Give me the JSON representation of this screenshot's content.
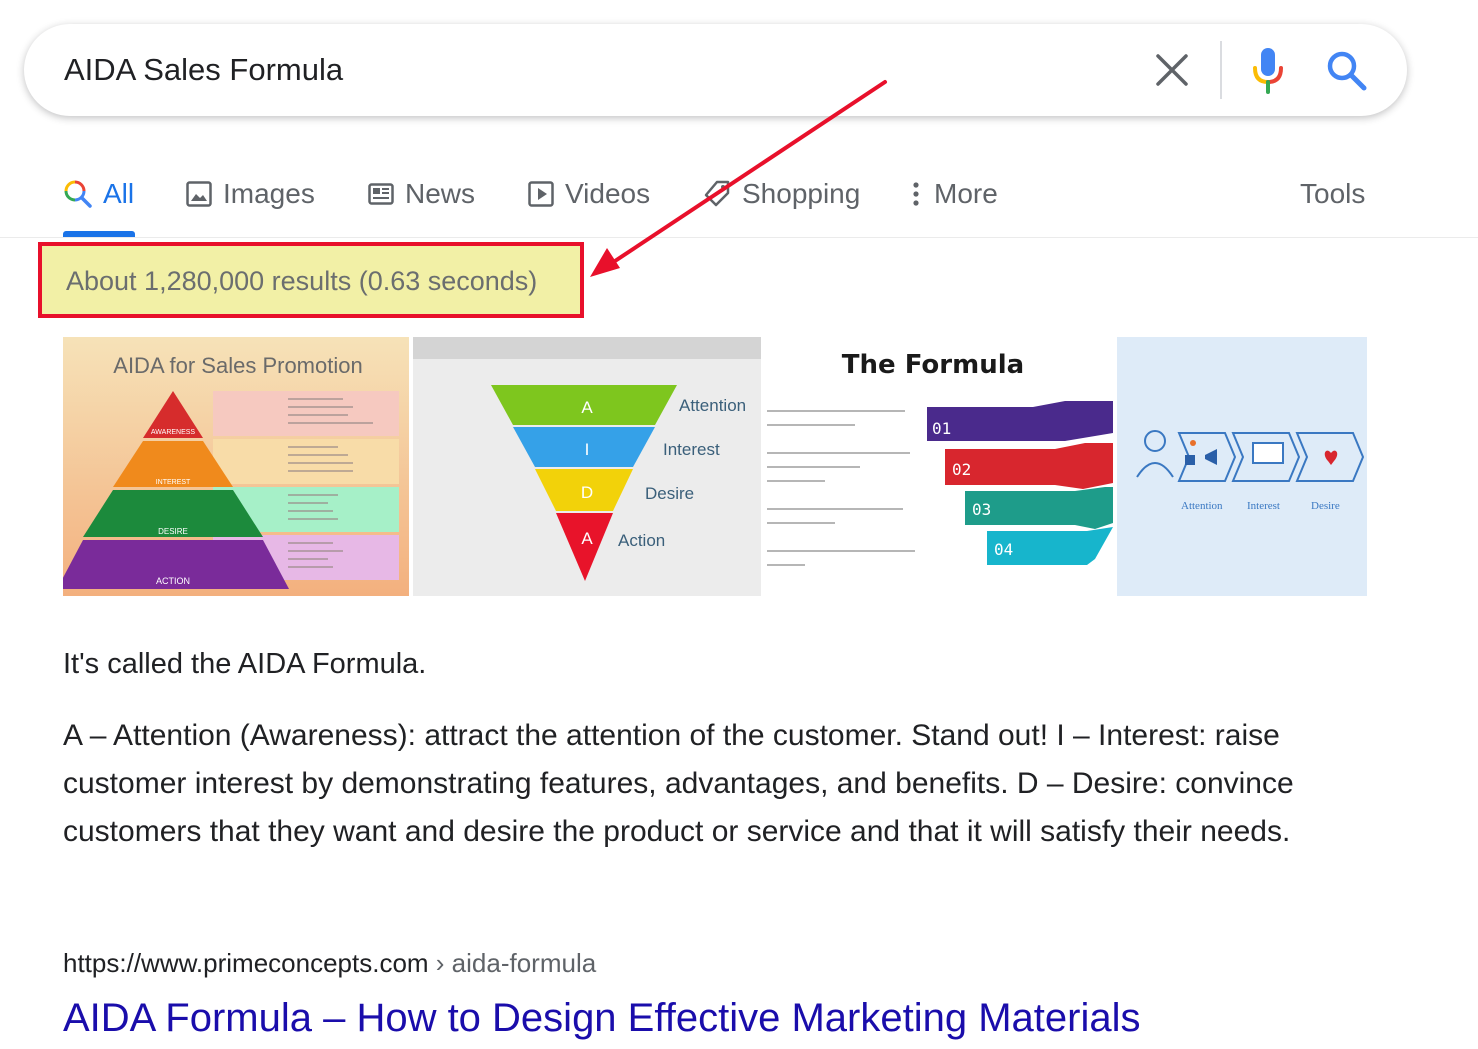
{
  "search": {
    "query": "AIDA Sales Formula",
    "clear_icon": "close-icon",
    "mic_icon": "microphone-icon",
    "search_icon": "search-icon"
  },
  "tabs": [
    {
      "label": "All",
      "icon": "search-icon",
      "active": true
    },
    {
      "label": "Images",
      "icon": "image-icon"
    },
    {
      "label": "News",
      "icon": "newspaper-icon"
    },
    {
      "label": "Videos",
      "icon": "play-icon"
    },
    {
      "label": "Shopping",
      "icon": "tag-icon"
    },
    {
      "label": "More",
      "icon": "more-vert-icon"
    }
  ],
  "tools_label": "Tools",
  "stats": "About 1,280,000 results (0.63 seconds)",
  "images": {
    "img1": {
      "title": "AIDA for Sales Promotion",
      "levels": [
        "AWARENESS",
        "INTEREST",
        "DESIRE",
        "ACTION"
      ]
    },
    "img2": {
      "letters": [
        "A",
        "I",
        "D",
        "A"
      ],
      "labels": [
        "Attention",
        "Interest",
        "Desire",
        "Action"
      ]
    },
    "img3": {
      "title": "The Formula",
      "steps": [
        "01",
        "02",
        "03",
        "04"
      ]
    },
    "img4": {
      "labels": [
        "Attention",
        "Interest",
        "Desire"
      ]
    }
  },
  "snippet": {
    "lead": "It's called the AIDA Formula.",
    "body": "A – Attention (Awareness): attract the attention of the customer. Stand out! I – Interest: raise customer interest by demonstrating features, advantages, and benefits. D – Desire: convince customers that they want and desire the product or service and that it will satisfy their needs."
  },
  "result": {
    "cite_host": "https://www.primeconcepts.com",
    "cite_path": " › aida-formula",
    "title": "AIDA Formula – How to Design Effective Marketing Materials"
  },
  "colors": {
    "tab_active": "#1a73e8",
    "link": "#1a0dab",
    "annotation": "#e8102b",
    "highlight": "#f2f0a6"
  }
}
